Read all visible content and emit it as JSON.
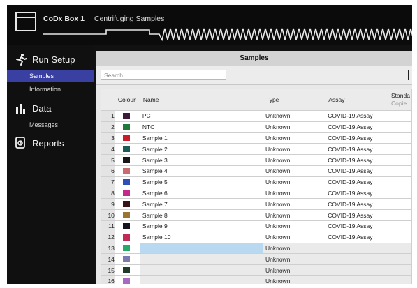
{
  "header": {
    "device_name": "CoDx Box 1",
    "status": "Centrifuging Samples"
  },
  "sidebar": {
    "sections": [
      {
        "label": "Run Setup",
        "icon": "runner-icon"
      },
      {
        "label": "Data",
        "icon": "bar-chart-icon"
      },
      {
        "label": "Reports",
        "icon": "reports-icon"
      }
    ],
    "run_setup_items": [
      "Samples",
      "Information"
    ],
    "data_items": [
      "Messages"
    ],
    "active_item": "Samples"
  },
  "samples_panel": {
    "title": "Samples",
    "search_placeholder": "Search",
    "columns": {
      "colour": "Colour",
      "name": "Name",
      "type": "Type",
      "assay": "Assay",
      "standard": "Standa",
      "standard_sub": "Copie"
    },
    "rows": [
      {
        "n": "1",
        "color": "#3b1a3a",
        "name": "PC",
        "type": "Unknown",
        "assay": "COVID-19 Assay"
      },
      {
        "n": "2",
        "color": "#1e7a3c",
        "name": "NTC",
        "type": "Unknown",
        "assay": "COVID-19 Assay"
      },
      {
        "n": "3",
        "color": "#c81e2c",
        "name": "Sample 1",
        "type": "Unknown",
        "assay": "COVID-19 Assay"
      },
      {
        "n": "4",
        "color": "#1b5a58",
        "name": "Sample 2",
        "type": "Unknown",
        "assay": "COVID-19 Assay"
      },
      {
        "n": "5",
        "color": "#1a1418",
        "name": "Sample 3",
        "type": "Unknown",
        "assay": "COVID-19 Assay"
      },
      {
        "n": "6",
        "color": "#c96a6e",
        "name": "Sample 4",
        "type": "Unknown",
        "assay": "COVID-19 Assay"
      },
      {
        "n": "7",
        "color": "#2f4fb8",
        "name": "Sample 5",
        "type": "Unknown",
        "assay": "COVID-19 Assay"
      },
      {
        "n": "8",
        "color": "#c42a8c",
        "name": "Sample 6",
        "type": "Unknown",
        "assay": "COVID-19 Assay"
      },
      {
        "n": "9",
        "color": "#3a1318",
        "name": "Sample 7",
        "type": "Unknown",
        "assay": "COVID-19 Assay"
      },
      {
        "n": "10",
        "color": "#9a7432",
        "name": "Sample 8",
        "type": "Unknown",
        "assay": "COVID-19 Assay"
      },
      {
        "n": "11",
        "color": "#141420",
        "name": "Sample 9",
        "type": "Unknown",
        "assay": "COVID-19 Assay"
      },
      {
        "n": "12",
        "color": "#c42a58",
        "name": "Sample 10",
        "type": "Unknown",
        "assay": "COVID-19 Assay"
      },
      {
        "n": "13",
        "color": "#2aa86a",
        "name": "",
        "type": "Unknown",
        "assay": ""
      },
      {
        "n": "14",
        "color": "#7a7ab0",
        "name": "",
        "type": "Unknown",
        "assay": ""
      },
      {
        "n": "15",
        "color": "#1f3a2a",
        "name": "",
        "type": "Unknown",
        "assay": ""
      },
      {
        "n": "16",
        "color": "#a86ac0",
        "name": "",
        "type": "Unknown",
        "assay": ""
      }
    ]
  }
}
